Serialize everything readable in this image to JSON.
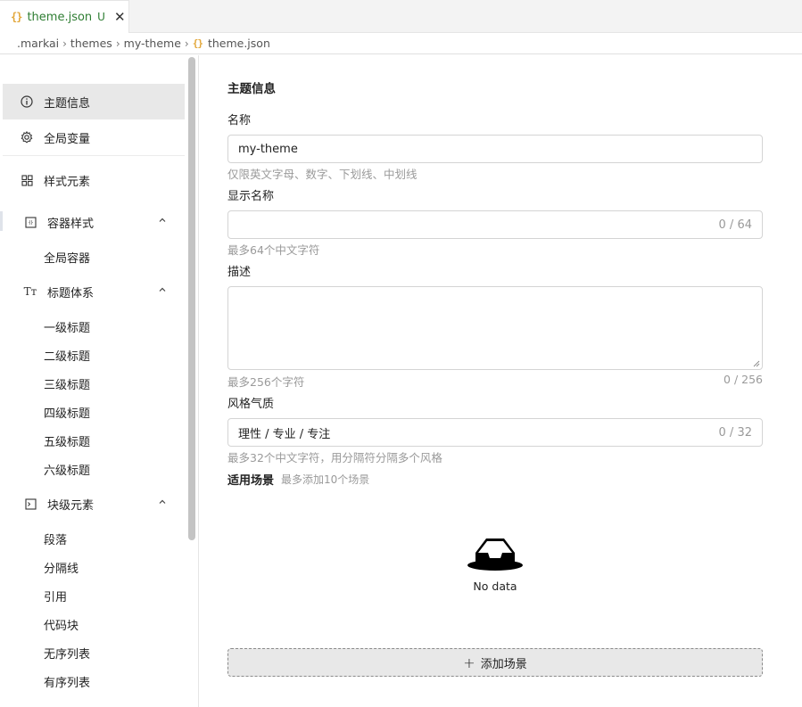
{
  "tab": {
    "title": "theme.json",
    "badge": "U",
    "icon": "braces-icon"
  },
  "breadcrumb": {
    "parts": [
      ".markai",
      "themes",
      "my-theme"
    ],
    "file": "theme.json"
  },
  "sidebar": {
    "items": {
      "theme_info": "主题信息",
      "global_vars": "全局变量",
      "style_elements": "样式元素",
      "container_styles": "容器样式",
      "global_container": "全局容器",
      "heading_system": "标题体系",
      "h1": "一级标题",
      "h2": "二级标题",
      "h3": "三级标题",
      "h4": "四级标题",
      "h5": "五级标题",
      "h6": "六级标题",
      "block_elements": "块级元素",
      "paragraph": "段落",
      "divider": "分隔线",
      "quote": "引用",
      "code_block": "代码块",
      "unordered_list": "无序列表",
      "ordered_list": "有序列表"
    }
  },
  "form": {
    "section_title": "主题信息",
    "name_label": "名称",
    "name_value": "my-theme",
    "name_hint": "仅限英文字母、数字、下划线、中划线",
    "display_label": "显示名称",
    "display_count": "0 / 64",
    "display_hint": "最多64个中文字符",
    "desc_label": "描述",
    "desc_hint": "最多256个字符",
    "desc_count": "0 / 256",
    "style_label": "风格气质",
    "style_value": "理性 / 专业 / 专注",
    "style_count": "0 / 32",
    "style_hint": "最多32个中文字符，用分隔符分隔多个风格",
    "scene_label": "适用场景",
    "scene_hint": "最多添加10个场景",
    "empty_text": "No data",
    "add_button": "添加场景"
  },
  "colors": {
    "tab_modified": "#2e7d32",
    "json_icon": "#e2a73a",
    "active_item_bg": "#e8e8e8"
  }
}
